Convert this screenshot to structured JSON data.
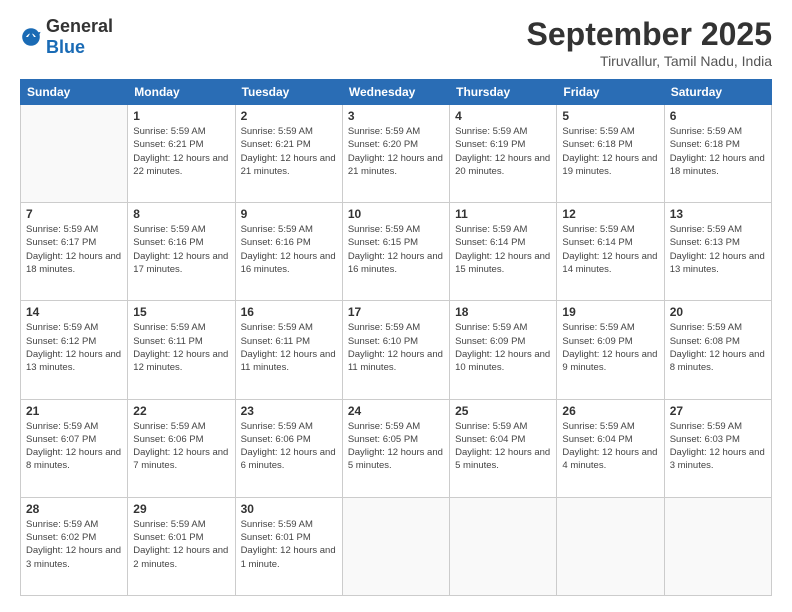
{
  "logo": {
    "general": "General",
    "blue": "Blue"
  },
  "header": {
    "month": "September 2025",
    "location": "Tiruvallur, Tamil Nadu, India"
  },
  "days_of_week": [
    "Sunday",
    "Monday",
    "Tuesday",
    "Wednesday",
    "Thursday",
    "Friday",
    "Saturday"
  ],
  "weeks": [
    [
      {
        "num": "",
        "sunrise": "",
        "sunset": "",
        "daylight": ""
      },
      {
        "num": "1",
        "sunrise": "Sunrise: 5:59 AM",
        "sunset": "Sunset: 6:21 PM",
        "daylight": "Daylight: 12 hours and 22 minutes."
      },
      {
        "num": "2",
        "sunrise": "Sunrise: 5:59 AM",
        "sunset": "Sunset: 6:21 PM",
        "daylight": "Daylight: 12 hours and 21 minutes."
      },
      {
        "num": "3",
        "sunrise": "Sunrise: 5:59 AM",
        "sunset": "Sunset: 6:20 PM",
        "daylight": "Daylight: 12 hours and 21 minutes."
      },
      {
        "num": "4",
        "sunrise": "Sunrise: 5:59 AM",
        "sunset": "Sunset: 6:19 PM",
        "daylight": "Daylight: 12 hours and 20 minutes."
      },
      {
        "num": "5",
        "sunrise": "Sunrise: 5:59 AM",
        "sunset": "Sunset: 6:18 PM",
        "daylight": "Daylight: 12 hours and 19 minutes."
      },
      {
        "num": "6",
        "sunrise": "Sunrise: 5:59 AM",
        "sunset": "Sunset: 6:18 PM",
        "daylight": "Daylight: 12 hours and 18 minutes."
      }
    ],
    [
      {
        "num": "7",
        "sunrise": "Sunrise: 5:59 AM",
        "sunset": "Sunset: 6:17 PM",
        "daylight": "Daylight: 12 hours and 18 minutes."
      },
      {
        "num": "8",
        "sunrise": "Sunrise: 5:59 AM",
        "sunset": "Sunset: 6:16 PM",
        "daylight": "Daylight: 12 hours and 17 minutes."
      },
      {
        "num": "9",
        "sunrise": "Sunrise: 5:59 AM",
        "sunset": "Sunset: 6:16 PM",
        "daylight": "Daylight: 12 hours and 16 minutes."
      },
      {
        "num": "10",
        "sunrise": "Sunrise: 5:59 AM",
        "sunset": "Sunset: 6:15 PM",
        "daylight": "Daylight: 12 hours and 16 minutes."
      },
      {
        "num": "11",
        "sunrise": "Sunrise: 5:59 AM",
        "sunset": "Sunset: 6:14 PM",
        "daylight": "Daylight: 12 hours and 15 minutes."
      },
      {
        "num": "12",
        "sunrise": "Sunrise: 5:59 AM",
        "sunset": "Sunset: 6:14 PM",
        "daylight": "Daylight: 12 hours and 14 minutes."
      },
      {
        "num": "13",
        "sunrise": "Sunrise: 5:59 AM",
        "sunset": "Sunset: 6:13 PM",
        "daylight": "Daylight: 12 hours and 13 minutes."
      }
    ],
    [
      {
        "num": "14",
        "sunrise": "Sunrise: 5:59 AM",
        "sunset": "Sunset: 6:12 PM",
        "daylight": "Daylight: 12 hours and 13 minutes."
      },
      {
        "num": "15",
        "sunrise": "Sunrise: 5:59 AM",
        "sunset": "Sunset: 6:11 PM",
        "daylight": "Daylight: 12 hours and 12 minutes."
      },
      {
        "num": "16",
        "sunrise": "Sunrise: 5:59 AM",
        "sunset": "Sunset: 6:11 PM",
        "daylight": "Daylight: 12 hours and 11 minutes."
      },
      {
        "num": "17",
        "sunrise": "Sunrise: 5:59 AM",
        "sunset": "Sunset: 6:10 PM",
        "daylight": "Daylight: 12 hours and 11 minutes."
      },
      {
        "num": "18",
        "sunrise": "Sunrise: 5:59 AM",
        "sunset": "Sunset: 6:09 PM",
        "daylight": "Daylight: 12 hours and 10 minutes."
      },
      {
        "num": "19",
        "sunrise": "Sunrise: 5:59 AM",
        "sunset": "Sunset: 6:09 PM",
        "daylight": "Daylight: 12 hours and 9 minutes."
      },
      {
        "num": "20",
        "sunrise": "Sunrise: 5:59 AM",
        "sunset": "Sunset: 6:08 PM",
        "daylight": "Daylight: 12 hours and 8 minutes."
      }
    ],
    [
      {
        "num": "21",
        "sunrise": "Sunrise: 5:59 AM",
        "sunset": "Sunset: 6:07 PM",
        "daylight": "Daylight: 12 hours and 8 minutes."
      },
      {
        "num": "22",
        "sunrise": "Sunrise: 5:59 AM",
        "sunset": "Sunset: 6:06 PM",
        "daylight": "Daylight: 12 hours and 7 minutes."
      },
      {
        "num": "23",
        "sunrise": "Sunrise: 5:59 AM",
        "sunset": "Sunset: 6:06 PM",
        "daylight": "Daylight: 12 hours and 6 minutes."
      },
      {
        "num": "24",
        "sunrise": "Sunrise: 5:59 AM",
        "sunset": "Sunset: 6:05 PM",
        "daylight": "Daylight: 12 hours and 5 minutes."
      },
      {
        "num": "25",
        "sunrise": "Sunrise: 5:59 AM",
        "sunset": "Sunset: 6:04 PM",
        "daylight": "Daylight: 12 hours and 5 minutes."
      },
      {
        "num": "26",
        "sunrise": "Sunrise: 5:59 AM",
        "sunset": "Sunset: 6:04 PM",
        "daylight": "Daylight: 12 hours and 4 minutes."
      },
      {
        "num": "27",
        "sunrise": "Sunrise: 5:59 AM",
        "sunset": "Sunset: 6:03 PM",
        "daylight": "Daylight: 12 hours and 3 minutes."
      }
    ],
    [
      {
        "num": "28",
        "sunrise": "Sunrise: 5:59 AM",
        "sunset": "Sunset: 6:02 PM",
        "daylight": "Daylight: 12 hours and 3 minutes."
      },
      {
        "num": "29",
        "sunrise": "Sunrise: 5:59 AM",
        "sunset": "Sunset: 6:01 PM",
        "daylight": "Daylight: 12 hours and 2 minutes."
      },
      {
        "num": "30",
        "sunrise": "Sunrise: 5:59 AM",
        "sunset": "Sunset: 6:01 PM",
        "daylight": "Daylight: 12 hours and 1 minute."
      },
      {
        "num": "",
        "sunrise": "",
        "sunset": "",
        "daylight": ""
      },
      {
        "num": "",
        "sunrise": "",
        "sunset": "",
        "daylight": ""
      },
      {
        "num": "",
        "sunrise": "",
        "sunset": "",
        "daylight": ""
      },
      {
        "num": "",
        "sunrise": "",
        "sunset": "",
        "daylight": ""
      }
    ]
  ]
}
